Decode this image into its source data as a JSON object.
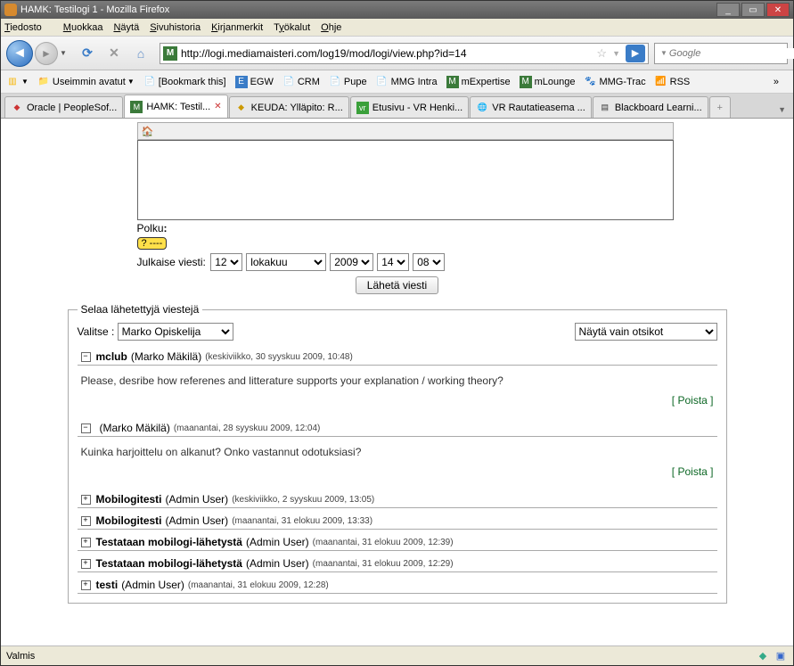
{
  "window": {
    "title": "HAMK: Testilogi 1 - Mozilla Firefox"
  },
  "menu": {
    "items": [
      "Tiedosto",
      "Muokkaa",
      "Näytä",
      "Sivuhistoria",
      "Kirjanmerkit",
      "Työkalut",
      "Ohje"
    ]
  },
  "url": "http://logi.mediamaisteri.com/log19/mod/logi/view.php?id=14",
  "search": {
    "placeholder": "Google"
  },
  "bookmarks": [
    {
      "label": "Useimmin avatut",
      "icon": "folder"
    },
    {
      "label": "[Bookmark this]",
      "icon": "page"
    },
    {
      "label": "EGW",
      "icon": "E"
    },
    {
      "label": "CRM",
      "icon": "page"
    },
    {
      "label": "Pupe",
      "icon": "page"
    },
    {
      "label": "MMG Intra",
      "icon": "page"
    },
    {
      "label": "mExpertise",
      "icon": "M"
    },
    {
      "label": "mLounge",
      "icon": "M"
    },
    {
      "label": "MMG-Trac",
      "icon": "paw"
    },
    {
      "label": "RSS",
      "icon": "rss"
    }
  ],
  "tabs": [
    {
      "label": "Oracle | PeopleSof...",
      "active": false
    },
    {
      "label": "HAMK: Testil...",
      "active": true
    },
    {
      "label": "KEUDA: Ylläpito: R...",
      "active": false
    },
    {
      "label": "Etusivu - VR Henki...",
      "active": false
    },
    {
      "label": "VR Rautatieasema ...",
      "active": false
    },
    {
      "label": "Blackboard Learni...",
      "active": false
    }
  ],
  "editor": {
    "path_label": "Polku",
    "help_text": "? ----",
    "publish_label": "Julkaise viesti:",
    "date": {
      "day": "12",
      "month": "lokakuu",
      "year": "2009",
      "hour": "14",
      "minute": "08"
    },
    "send_button": "Lähetä viesti"
  },
  "browse": {
    "legend": "Selaa lähetettyjä viestejä",
    "select_label": "Valitse :",
    "selected_user": "Marko Opiskelija",
    "view_mode": "Näytä vain otsikot",
    "delete_label": "Poista",
    "messages": [
      {
        "expanded": true,
        "title": "mclub",
        "author": "(Marko Mäkilä)",
        "meta": "(keskiviikko, 30 syyskuu 2009, 10:48)",
        "body": "Please, desribe how referenes and litterature supports your explanation / working theory?"
      },
      {
        "expanded": true,
        "title": "",
        "author": "(Marko Mäkilä)",
        "meta": "(maanantai, 28 syyskuu 2009, 12:04)",
        "body": "Kuinka harjoittelu on alkanut? Onko vastannut odotuksiasi?"
      },
      {
        "expanded": false,
        "title": "Mobilogitesti",
        "author": "(Admin User)",
        "meta": "(keskiviikko, 2 syyskuu 2009, 13:05)"
      },
      {
        "expanded": false,
        "title": "Mobilogitesti",
        "author": "(Admin User)",
        "meta": "(maanantai, 31 elokuu 2009, 13:33)"
      },
      {
        "expanded": false,
        "title": "Testataan mobilogi-lähetystä",
        "author": "(Admin User)",
        "meta": "(maanantai, 31 elokuu 2009, 12:39)"
      },
      {
        "expanded": false,
        "title": "Testataan mobilogi-lähetystä",
        "author": "(Admin User)",
        "meta": "(maanantai, 31 elokuu 2009, 12:29)"
      },
      {
        "expanded": false,
        "title": "testi",
        "author": "(Admin User)",
        "meta": "(maanantai, 31 elokuu 2009, 12:28)"
      }
    ]
  },
  "status": {
    "text": "Valmis"
  }
}
